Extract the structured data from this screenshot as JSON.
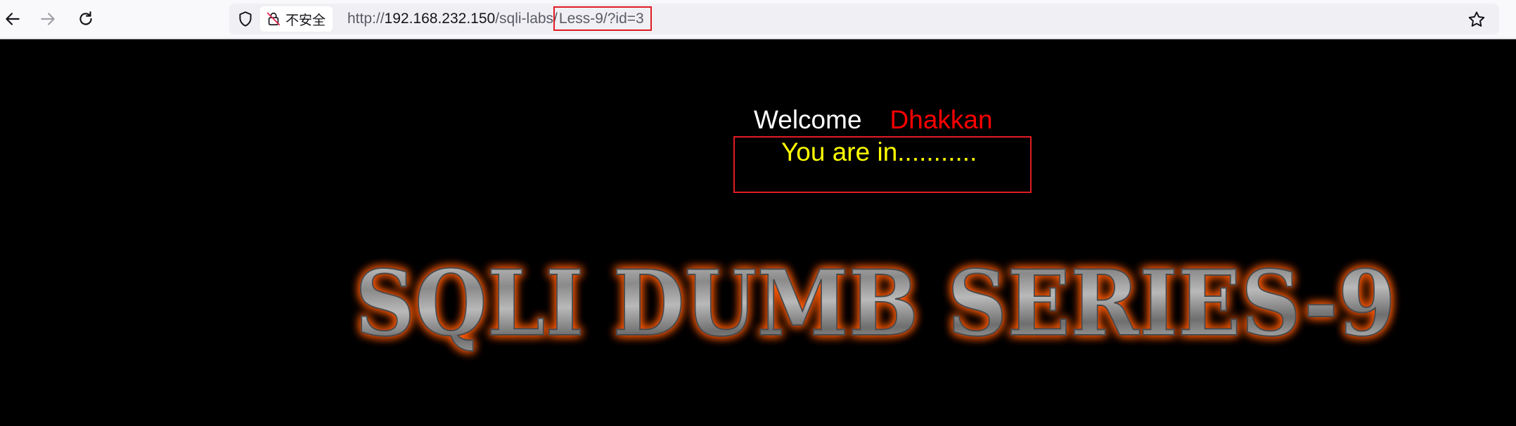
{
  "browser": {
    "security_label": "不安全",
    "url": {
      "scheme": "http://",
      "host": "192.168.232.150",
      "path": "/sqli-labs/",
      "query_path": "Less-9/?id=3"
    },
    "icons": [
      "back-icon",
      "forward-icon",
      "reload-icon",
      "shield-icon",
      "not-secure-lock-icon",
      "bookmark-star-icon"
    ]
  },
  "page": {
    "welcome_label": "Welcome",
    "user_name": "Dhakkan",
    "result_text": "You are in...........",
    "banner_text": "SQLI DUMB SERIES-9"
  },
  "colors": {
    "background": "#000000",
    "welcome": "#ffffff",
    "user_name": "#ff0000",
    "result_text": "#ffff00",
    "highlight_box": "#e01b24",
    "banner_glow": "#ff5a00"
  }
}
